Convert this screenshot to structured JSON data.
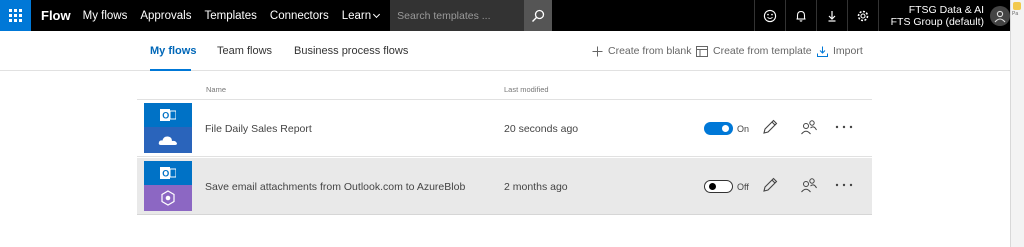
{
  "header": {
    "brand": "Flow",
    "nav": [
      "My flows",
      "Approvals",
      "Templates",
      "Connectors"
    ],
    "learn_label": "Learn",
    "search_placeholder": "Search templates ...",
    "icons": [
      "smiley-icon",
      "bell-icon",
      "download-icon",
      "gear-icon"
    ],
    "user_line1": "FTSG Data & AI",
    "user_line2": "FTS Group (default)"
  },
  "sliver": {
    "text": "Pa"
  },
  "tabs": {
    "items": [
      "My flows",
      "Team flows",
      "Business process flows"
    ],
    "active": "My flows"
  },
  "actions": {
    "create_blank": "Create from blank",
    "create_template": "Create from template",
    "import": "Import"
  },
  "table": {
    "col_name": "Name",
    "col_modified": "Last modified",
    "rows": [
      {
        "name": "File Daily Sales Report",
        "modified": "20 seconds ago",
        "state": "On",
        "top_icon": "outlook-icon",
        "bottom_icon": "onedrive-icon",
        "bottom_color": "#2a64bb"
      },
      {
        "name": "Save email attachments from Outlook.com to AzureBlob",
        "modified": "2 months ago",
        "state": "Off",
        "top_icon": "outlook-icon",
        "bottom_icon": "azure-blob-icon",
        "bottom_color": "#8c67c3"
      }
    ]
  },
  "colors": {
    "accent": "#0078d7",
    "topbar": "#000000",
    "outlook_blue": "#0072c6"
  }
}
